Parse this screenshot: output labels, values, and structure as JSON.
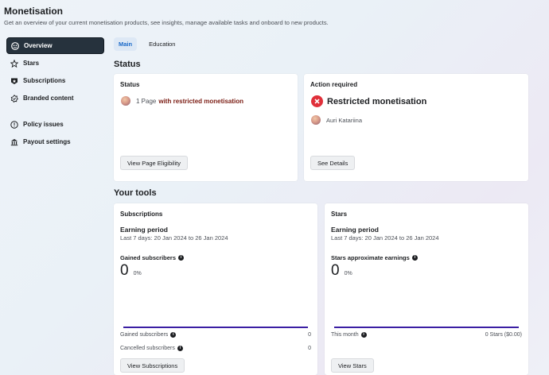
{
  "header": {
    "title": "Monetisation",
    "subtitle": "Get an overview of your current monetisation products, see insights, manage available tasks and onboard to new products."
  },
  "sidebar": {
    "items": [
      {
        "label": "Overview",
        "icon": "overview-icon"
      },
      {
        "label": "Stars",
        "icon": "stars-icon"
      },
      {
        "label": "Subscriptions",
        "icon": "subscriptions-icon"
      },
      {
        "label": "Branded content",
        "icon": "branded-content-icon"
      },
      {
        "label": "Policy issues",
        "icon": "policy-icon"
      },
      {
        "label": "Payout settings",
        "icon": "payout-icon"
      }
    ]
  },
  "tabs": [
    {
      "label": "Main"
    },
    {
      "label": "Education"
    }
  ],
  "status_section": {
    "heading": "Status",
    "status_card": {
      "title": "Status",
      "count_text": "1 Page",
      "status_text": "with restricted monetisation",
      "button": "View Page Eligibility"
    },
    "action_card": {
      "title": "Action required",
      "headline": "Restricted monetisation",
      "user": "Auri Katariina",
      "button": "See Details"
    }
  },
  "tools_section": {
    "heading": "Your tools",
    "subscriptions": {
      "title": "Subscriptions",
      "period_label": "Earning period",
      "period_range": "Last 7 days: 20 Jan 2024 to 26 Jan 2024",
      "metric_label": "Gained subscribers",
      "metric_value": "0",
      "metric_pct": "0%",
      "rows": [
        {
          "label": "Gained subscribers",
          "value": "0"
        },
        {
          "label": "Cancelled subscribers",
          "value": "0"
        }
      ],
      "button": "View Subscriptions"
    },
    "stars": {
      "title": "Stars",
      "period_label": "Earning period",
      "period_range": "Last 7 days: 20 Jan 2024 to 26 Jan 2024",
      "metric_label": "Stars approximate earnings",
      "metric_value": "0",
      "metric_pct": "0%",
      "rows": [
        {
          "label": "This month",
          "value": "0 Stars ($0.00)"
        }
      ],
      "button": "View Stars"
    }
  },
  "colors": {
    "active_nav": "#26323d",
    "tab_active_text": "#1b6ac9",
    "restricted_text": "#7a1b12",
    "error_red": "#e0303a",
    "chart_line": "#3b1fa3"
  }
}
